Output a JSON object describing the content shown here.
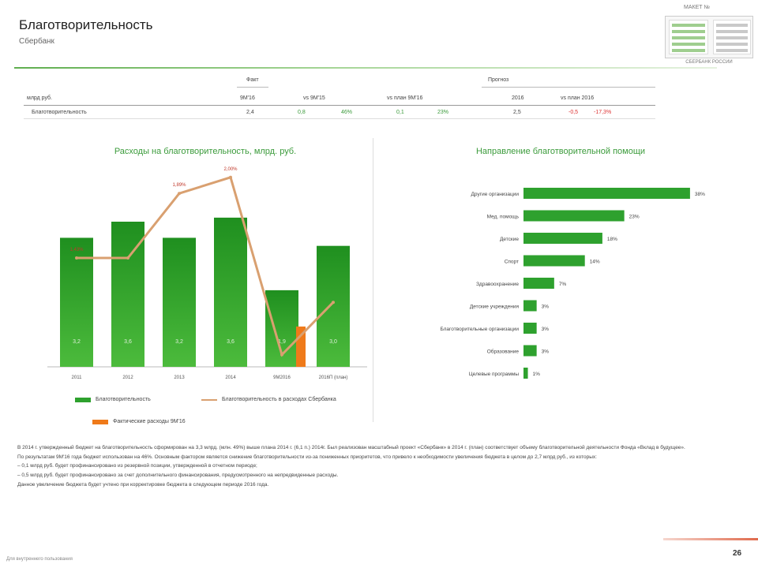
{
  "header": {
    "title": "Благотворительность",
    "subtitle": "Сбербанк",
    "mini_top": "МАКЕТ №",
    "mini_bottom": "СБЕРБАНК РОССИИ"
  },
  "table": {
    "group_fact": "Факт",
    "group_forecast": "Прогноз",
    "unit": "млрд руб.",
    "columns": [
      "9M'16",
      "vs 9M'15",
      "vs план 9M'16",
      "2016",
      "vs план 2016"
    ],
    "row_label": "Благотворительность",
    "cells": [
      "2,4",
      "0,8",
      "46%",
      "0,1",
      "23%",
      "2,5",
      "-0,5",
      "-17,3%"
    ]
  },
  "colors": {
    "bar": "#2ea12e",
    "line": "#d9a070",
    "orange": "#ef7a1a",
    "accent": "#3b9b3b"
  },
  "chart_data": [
    {
      "type": "bar",
      "title": "Расходы на благотворительность, млрд. руб.",
      "categories": [
        "2011",
        "2012",
        "2013",
        "2014",
        "9М2016",
        "2016П (план)"
      ],
      "series": [
        {
          "name": "Благотворительность",
          "values": [
            3.2,
            3.6,
            3.2,
            3.7,
            1.9,
            3.0
          ],
          "labels": [
            "3,2",
            "3,6",
            "3,2",
            "3,6",
            "1,9",
            "3,0"
          ]
        },
        {
          "name": "Благотворительность в расходах Сбербанка",
          "type": "line",
          "values": [
            2.7,
            2.7,
            4.3,
            4.7,
            0.3,
            1.6
          ],
          "labels": [
            "1,43%",
            "",
            "1,89%",
            "2,00%",
            "",
            ""
          ]
        },
        {
          "name": "Фактические расходы 9M'16",
          "values": [
            null,
            null,
            null,
            null,
            1.0,
            null
          ]
        }
      ],
      "ylim": [
        0,
        4.5
      ]
    },
    {
      "type": "bar",
      "orientation": "horizontal",
      "title": "Направление благотворительной помощи",
      "categories": [
        "Другие организации",
        "Мед. помощь",
        "Детские",
        "Спорт",
        "Здравоохранение",
        "Детские учреждения",
        "Благотворительные организации",
        "Образование",
        "Целевые программы"
      ],
      "values": [
        38,
        23,
        18,
        14,
        7,
        3,
        3,
        3,
        1
      ],
      "labels": [
        "38%",
        "23%",
        "18%",
        "14%",
        "7%",
        "3%",
        "3%",
        "3%",
        "1%"
      ],
      "xlim": [
        0,
        40
      ]
    }
  ],
  "legend": {
    "bars": "Благотворительность",
    "line": "Благотворительность в расходах Сбербанка",
    "orange": "Фактические расходы 9M'16"
  },
  "paragraph": [
    "В 2014 г. утвержденный бюджет на благотворительность сформирован на 3,3 млрд. (млн. 49%) выше плана 2014 г. (6,1 п.) 2014г. Был реализован масштабный проект «Сбербанк» в 2014 г. (план) соответствует объему благотворительной деятельности Фонда «Вклад в будущее».",
    "По результатам 9М'16 года бюджет использован на 46%. Основным фактором является снижение благотворительности из-за пониженных приоритетов, что привело к необходимости увеличения бюджета в целом до 2,7 млрд руб., из которых:",
    "–  0,1 млрд руб. будет профинансировано из резервной позиции, утвержденной в отчетном периоде;",
    "–  0,5 млрд руб. будет профинансировано за счет дополнительного финансирования, предусмотренного на непредвиденные расходы.",
    "Данное увеличение бюджета будет учтено при корректировке бюджета в следующем периоде 2016 года."
  ],
  "footer": {
    "page": "26",
    "note": "Для внутреннего пользования"
  }
}
